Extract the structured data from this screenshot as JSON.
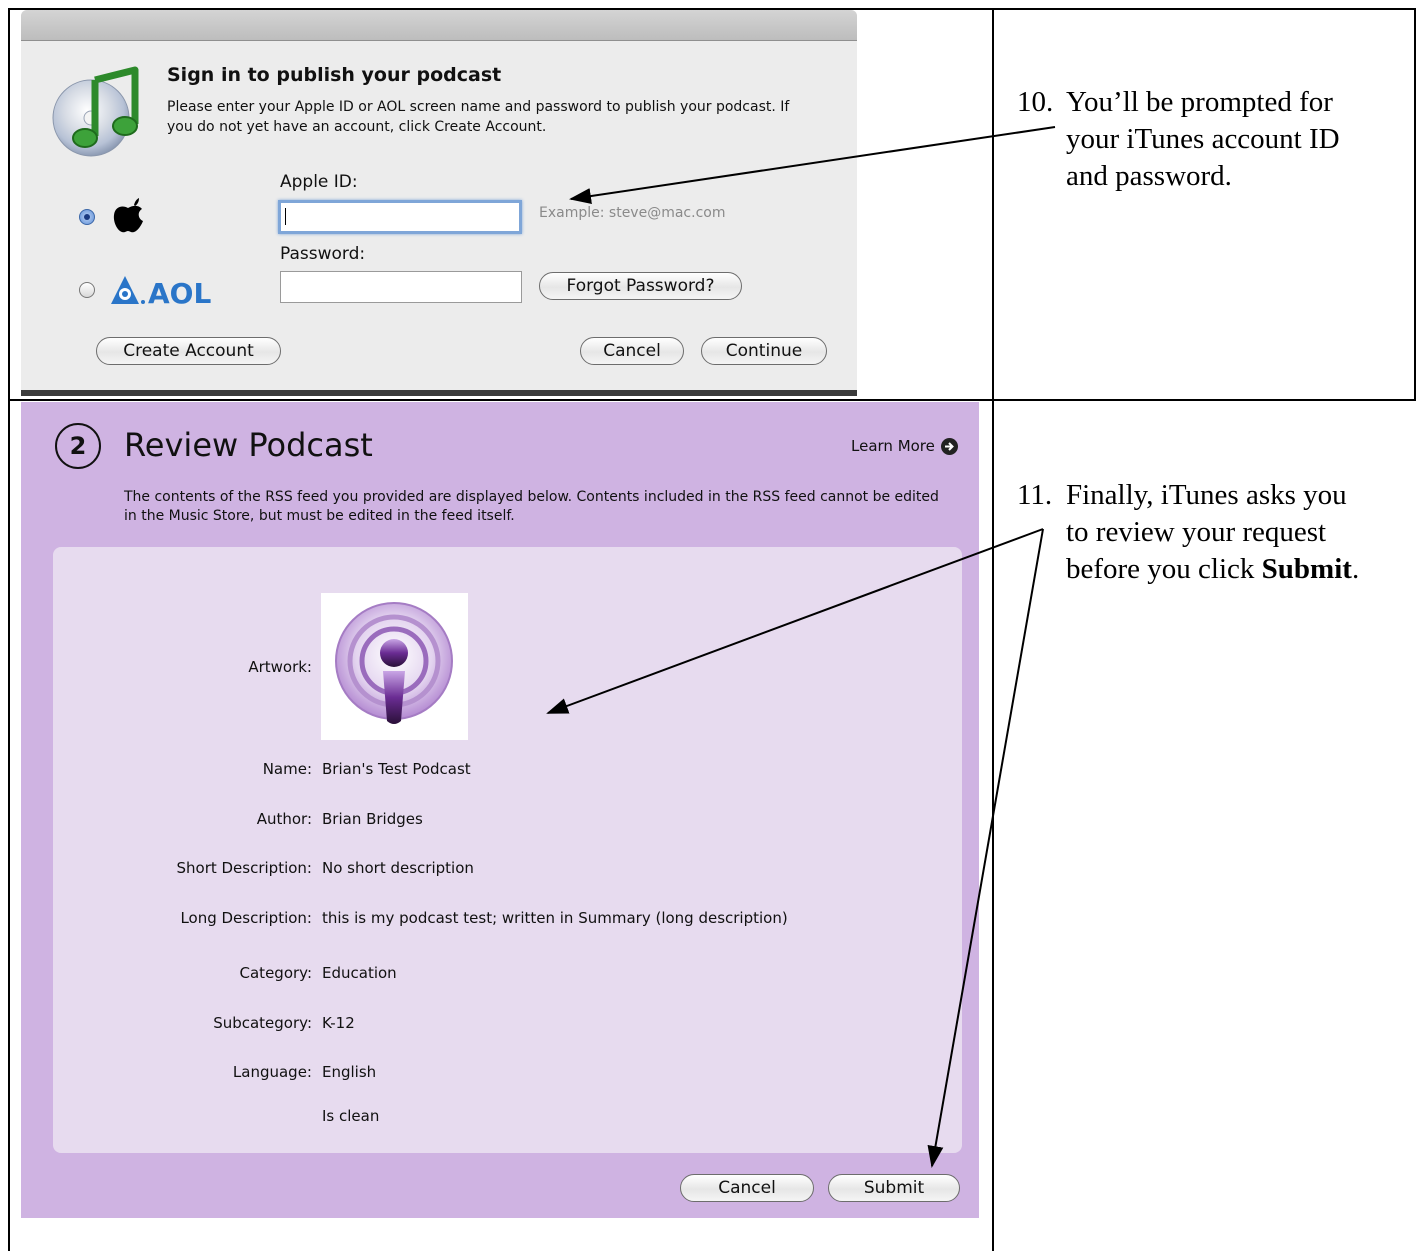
{
  "step10": {
    "number": "10.",
    "lines": [
      "You’ll be prompted for",
      "your iTunes account ID",
      "and password."
    ]
  },
  "step11": {
    "number": "11.",
    "line1": "Finally, iTunes asks you",
    "line2": "to review your request",
    "line3_pre": "before you click ",
    "line3_bold": "Submit",
    "line3_post": "."
  },
  "signin": {
    "title": "Sign in to publish your podcast",
    "message": "Please enter your Apple ID or AOL screen name and password to publish your podcast. If you do not yet have an account, click Create Account.",
    "apple_id_label": "Apple ID:",
    "apple_id_value": "",
    "example": "Example: steve@mac.com",
    "password_label": "Password:",
    "password_value": "",
    "aol_logo_text": "AOL",
    "apple_selected": true,
    "forgot_button": "Forgot Password?",
    "create_button": "Create Account",
    "cancel_button": "Cancel",
    "continue_button": "Continue"
  },
  "review": {
    "step_number": "2",
    "title": "Review Podcast",
    "learn_more": "Learn More",
    "message": "The contents of the RSS feed you provided are displayed below. Contents included in the RSS feed cannot be edited in the Music Store, but must be edited in the feed itself.",
    "artwork_label": "Artwork:",
    "fields": [
      {
        "label": "Name:",
        "value": "Brian's Test Podcast"
      },
      {
        "label": "Author:",
        "value": "Brian Bridges"
      },
      {
        "label": "Short Description:",
        "value": "No short description"
      },
      {
        "label": "Long Description:",
        "value": "this is my podcast test; written in Summary (long description)"
      },
      {
        "label": "Category:",
        "value": "Education"
      },
      {
        "label": "Subcategory:",
        "value": "K-12"
      },
      {
        "label": "Language:",
        "value": "English"
      }
    ],
    "clean_flag": "Is clean",
    "cancel_button": "Cancel",
    "submit_button": "Submit"
  },
  "colors": {
    "review_background": "#cfb3e2",
    "review_inner": "#e7dbef",
    "dialog_background": "#ececec",
    "focus_ring": "#7fa6d8",
    "aol_blue": "#2a75c8"
  }
}
